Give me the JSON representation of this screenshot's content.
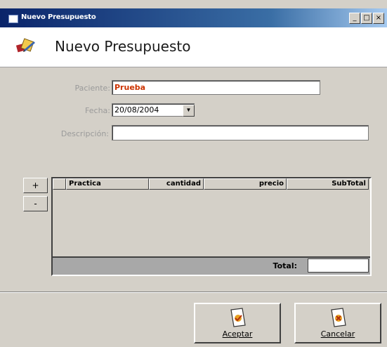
{
  "window": {
    "title": "Nuevo Presupuesto",
    "controls": {
      "minimize": "_",
      "maximize": "□",
      "close": "×"
    }
  },
  "header": {
    "title": "Nuevo Presupuesto",
    "icon": "notebook-pencil-icon"
  },
  "form": {
    "paciente_label": "Paciente:",
    "paciente_value": "Prueba",
    "fecha_label": "Fecha:",
    "fecha_value": "20/08/2004",
    "descripcion_label": "Descripción:",
    "descripcion_value": ""
  },
  "side_buttons": {
    "add": "+",
    "remove": "-"
  },
  "grid": {
    "columns": [
      "Practica",
      "cantidad",
      "precio",
      "SubTotal"
    ],
    "rows": [],
    "total_label": "Total:",
    "total_value": ""
  },
  "buttons": {
    "aceptar": "Aceptar",
    "cancelar": "Cancelar"
  },
  "colors": {
    "paciente_text": "#cc3300",
    "titlebar": "#0a246a",
    "face": "#d4d0c8"
  }
}
